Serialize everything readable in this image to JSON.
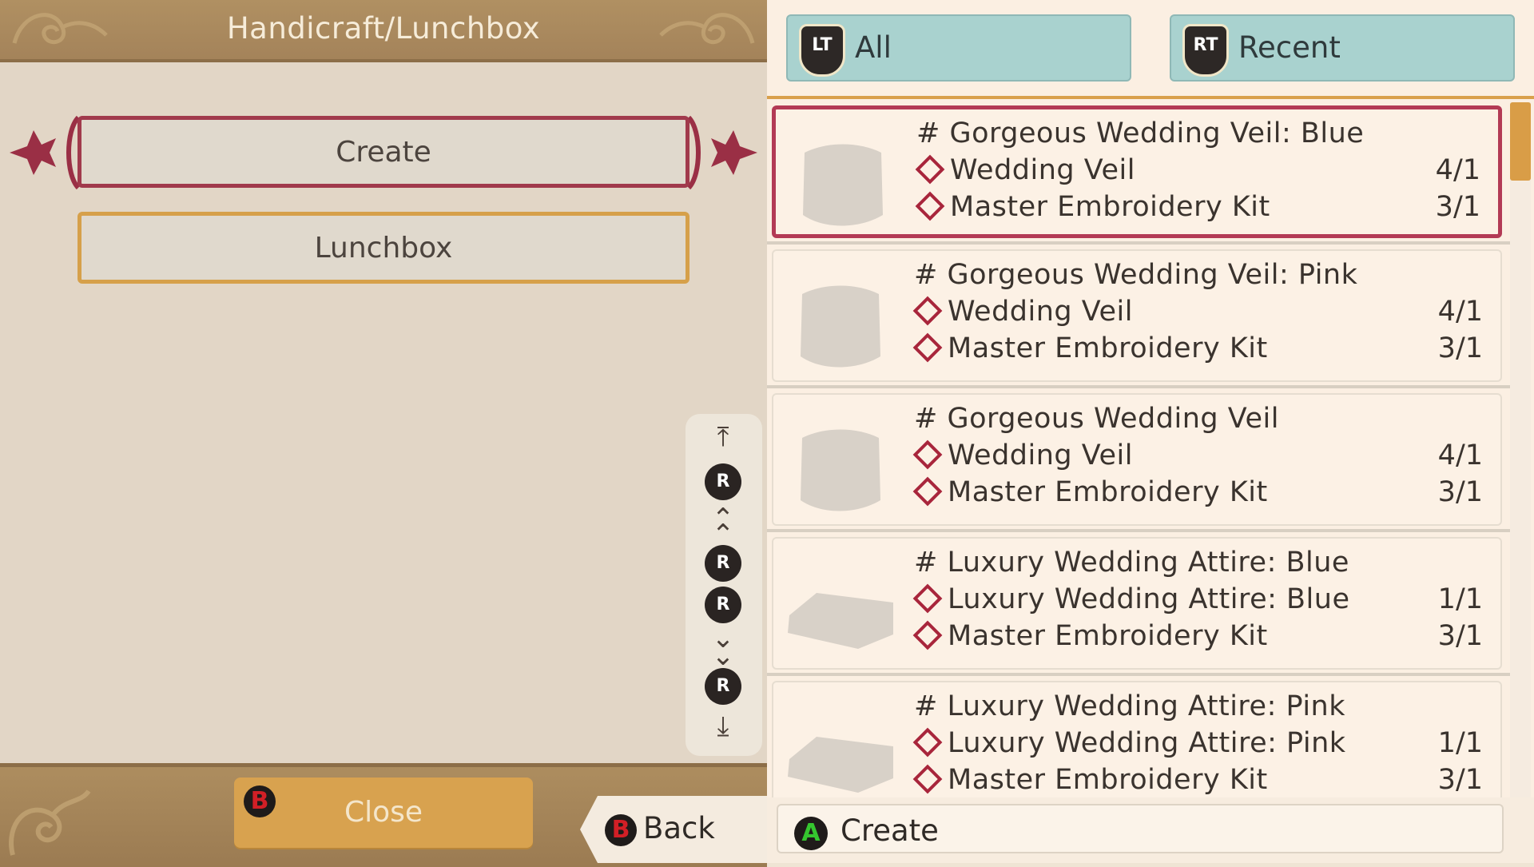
{
  "left": {
    "title": "Handicraft/Lunchbox",
    "menu": [
      {
        "label": "Create",
        "selected": true
      },
      {
        "label": "Lunchbox",
        "selected": false
      }
    ],
    "scroll_controls": {
      "button_glyph": "R",
      "icons": [
        "scroll-top-icon",
        "r-stick-up-icon",
        "page-up-icon",
        "r-stick-left-icon",
        "r-stick-right-icon",
        "page-down-icon",
        "r-stick-down-icon",
        "scroll-bottom-icon"
      ]
    },
    "close_label": "Close",
    "close_button_glyph": "B",
    "back_label": "Back",
    "back_button_glyph": "B"
  },
  "right": {
    "tabs": [
      {
        "button": "LT",
        "label": "All",
        "active": true
      },
      {
        "button": "RT",
        "label": "Recent",
        "active": false
      }
    ],
    "recipes": [
      {
        "name": "# Gorgeous Wedding Veil: Blue",
        "icon": "veil-icon",
        "selected": true,
        "materials": [
          {
            "name": "Wedding Veil",
            "qty": "4/1"
          },
          {
            "name": "Master Embroidery Kit",
            "qty": "3/1"
          }
        ]
      },
      {
        "name": "# Gorgeous Wedding Veil: Pink",
        "icon": "veil-icon",
        "selected": false,
        "materials": [
          {
            "name": "Wedding Veil",
            "qty": "4/1"
          },
          {
            "name": "Master Embroidery Kit",
            "qty": "3/1"
          }
        ]
      },
      {
        "name": "# Gorgeous Wedding Veil",
        "icon": "veil-icon",
        "selected": false,
        "materials": [
          {
            "name": "Wedding Veil",
            "qty": "4/1"
          },
          {
            "name": "Master Embroidery Kit",
            "qty": "3/1"
          }
        ]
      },
      {
        "name": "# Luxury Wedding Attire: Blue",
        "icon": "attire-icon",
        "selected": false,
        "materials": [
          {
            "name": "Luxury Wedding Attire: Blue",
            "qty": "1/1"
          },
          {
            "name": "Master Embroidery Kit",
            "qty": "3/1"
          }
        ]
      },
      {
        "name": "# Luxury Wedding Attire: Pink",
        "icon": "attire-icon",
        "selected": false,
        "materials": [
          {
            "name": "Luxury Wedding Attire: Pink",
            "qty": "1/1"
          },
          {
            "name": "Master Embroidery Kit",
            "qty": "3/1"
          }
        ]
      }
    ],
    "create_label": "Create",
    "create_button_glyph": "A"
  },
  "colors": {
    "accent_selected": "#a13a4c",
    "accent_gold": "#d6a04a",
    "tab_teal": "#a9d2cf",
    "material_diamond": "#a8253b"
  }
}
